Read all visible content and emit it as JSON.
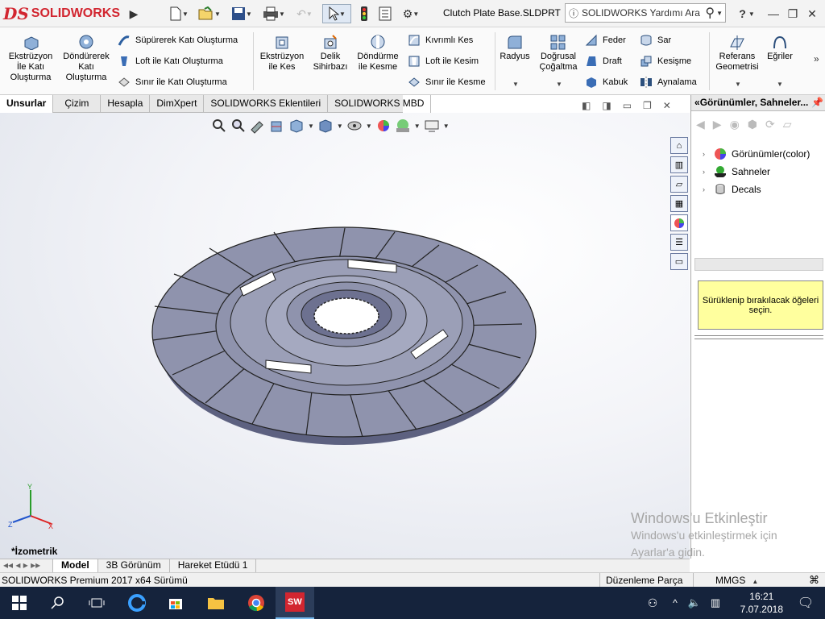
{
  "titlebar": {
    "logo_ds": "DS",
    "logo_name": "SOLIDWORKS",
    "document_title": "Clutch Plate Base.SLDPRT",
    "help_search_placeholder": "SOLIDWORKS Yardımı Ara",
    "help_label": "?",
    "icons": [
      "new-icon",
      "open-icon",
      "save-icon",
      "print-icon",
      "undo-icon",
      "select-icon",
      "traffic-light-icon",
      "file-properties-icon",
      "options-gear-icon"
    ]
  },
  "commands": {
    "big": [
      {
        "id": "extrude",
        "label": "Ekstrüzyon İle Katı Oluşturma"
      },
      {
        "id": "revolve",
        "label": "Döndürerek Katı Oluşturma"
      },
      {
        "id": "extrude-cut",
        "label": "Ekstrüzyon ile Kes"
      },
      {
        "id": "hole-wizard",
        "label": "Delik Sihirbazı"
      },
      {
        "id": "revolve-cut",
        "label": "Döndürme ile Kesme"
      },
      {
        "id": "fillet",
        "label": "Radyus"
      },
      {
        "id": "linear-pattern",
        "label": "Doğrusal Çoğaltma"
      },
      {
        "id": "reference-geometry",
        "label": "Referans Geometrisi"
      },
      {
        "id": "curves",
        "label": "Eğriler"
      }
    ],
    "small": [
      {
        "id": "sweep",
        "label": "Süpürerek Katı Oluşturma"
      },
      {
        "id": "loft",
        "label": "Loft ile Katı Oluşturma"
      },
      {
        "id": "boundary",
        "label": "Sınır ile Katı Oluşturma"
      },
      {
        "id": "swept-cut",
        "label": "Kıvrımlı Kes"
      },
      {
        "id": "lofted-cut",
        "label": "Loft ile Kesim"
      },
      {
        "id": "boundary-cut",
        "label": "Sınır ile Kesme"
      },
      {
        "id": "rib",
        "label": "Feder"
      },
      {
        "id": "draft",
        "label": "Draft"
      },
      {
        "id": "shell",
        "label": "Kabuk"
      },
      {
        "id": "wrap",
        "label": "Sar"
      },
      {
        "id": "intersect",
        "label": "Kesişme"
      },
      {
        "id": "mirror",
        "label": "Aynalama"
      }
    ]
  },
  "command_tabs": [
    "Unsurlar",
    "Çizim",
    "Hesapla",
    "DimXpert",
    "SOLIDWORKS Eklentileri",
    "SOLIDWORKS MBD"
  ],
  "graphics": {
    "view_label": "*İzometrik",
    "axis_labels": {
      "x": "X",
      "y": "Y",
      "z": "Z"
    }
  },
  "taskpane": {
    "title": "Görünümler, Sahneler...",
    "tree": [
      {
        "label": "Görünümler(color)",
        "icon": "appearances-icon"
      },
      {
        "label": "Sahneler",
        "icon": "scenes-icon"
      },
      {
        "label": "Decals",
        "icon": "decals-icon"
      }
    ],
    "drop_hint": "Sürüklenip bırakılacak öğeleri seçin."
  },
  "model_tabs": [
    "Model",
    "3B Görünüm",
    "Hareket Etüdü 1"
  ],
  "status": {
    "version": "SOLIDWORKS Premium 2017 x64 Sürümü",
    "mode": "Düzenleme Parça",
    "units": "MMGS"
  },
  "watermark": {
    "title": "Windows'u Etkinleştir",
    "line1": "Windows'u etkinleştirmek için",
    "line2": "Ayarlar'a gidin."
  },
  "taskbar": {
    "time": "16:21",
    "date": "7.07.2018"
  },
  "colors": {
    "brand": "#d22630",
    "part": "#8f93ad",
    "taskbar": "#15233c"
  }
}
